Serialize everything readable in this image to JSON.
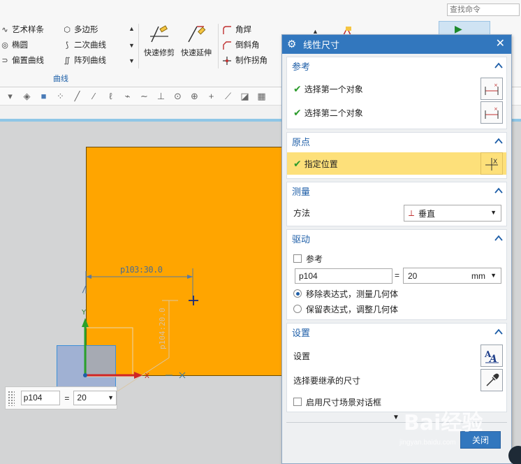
{
  "search": {
    "placeholder": "查找命令"
  },
  "ribbon": {
    "curve_items": [
      {
        "label": "艺术样条",
        "icon": "spline-icon"
      },
      {
        "label": "多边形",
        "icon": "polygon-icon"
      },
      {
        "label": "椭圆",
        "icon": "ellipse-icon"
      },
      {
        "label": "二次曲线",
        "icon": "conic-icon"
      },
      {
        "label": "偏置曲线",
        "icon": "offset-curve-icon"
      },
      {
        "label": "阵列曲线",
        "icon": "pattern-curve-icon"
      }
    ],
    "group_label": "曲线",
    "quick_trim": "快速修剪",
    "quick_extend": "快速延伸",
    "corner_items": [
      {
        "label": "角焊",
        "icon": "fillet-icon"
      },
      {
        "label": "倒斜角",
        "icon": "chamfer-icon"
      },
      {
        "label": "制作拐角",
        "icon": "make-corner-icon"
      }
    ]
  },
  "canvas": {
    "dimension_label": "p103:30.0",
    "vertical_dimension_label": "p104:20.0"
  },
  "float_input": {
    "name": "p104",
    "equals": "=",
    "value": "20"
  },
  "dialog": {
    "title": "线性尺寸",
    "reference": {
      "header": "参考",
      "first_object": "选择第一个对象",
      "second_object": "选择第二个对象"
    },
    "origin": {
      "header": "原点",
      "specify_location": "指定位置"
    },
    "measure": {
      "header": "测量",
      "method_label": "方法",
      "method_value": "垂直"
    },
    "driving": {
      "header": "驱动",
      "reference_checkbox": "参考",
      "name": "p104",
      "equals": "=",
      "value": "20",
      "unit": "mm",
      "option_remove": "移除表达式，测量几何体",
      "option_keep": "保留表达式，调整几何体"
    },
    "settings": {
      "header": "设置",
      "settings_label": "设置",
      "inherit_label": "选择要继承的尺寸",
      "enable_dialog": "启用尺寸场景对话框"
    },
    "ok": "关闭"
  },
  "colors": {
    "accent": "#3277be",
    "sketch_fill": "#ffa500",
    "highlight": "#fde07a",
    "check": "#2c9b2c"
  }
}
